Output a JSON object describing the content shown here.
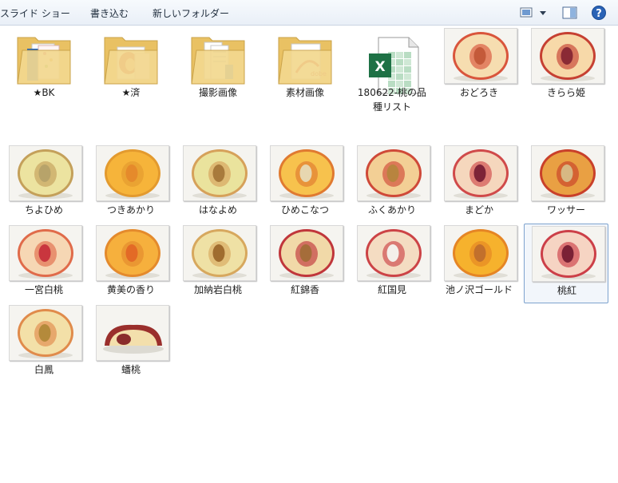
{
  "toolbar": {
    "commands": [
      "スライド ショー",
      "書き込む",
      "新しいフォルダー"
    ]
  },
  "colors": {
    "folder": "#f1d486",
    "excel_green": "#1e7145",
    "selection_border": "#7da2ce",
    "help_blue": "#2a63b6"
  },
  "items": [
    {
      "label": "★BK",
      "kind": "folder",
      "contents": "photoshop"
    },
    {
      "label": "★済",
      "kind": "folder",
      "contents": "peach"
    },
    {
      "label": "撮影画像",
      "kind": "folder",
      "contents": "docs"
    },
    {
      "label": "素材画像",
      "kind": "folder",
      "contents": "adobe"
    },
    {
      "label": "180622-桃の品種リスト",
      "kind": "excel",
      "icon": "excel-icon"
    },
    {
      "label": "おどろき",
      "kind": "peach",
      "flesh": "#f6ddb0",
      "red": "#d9553c",
      "pit": "#c45a3a"
    },
    {
      "label": "きらら姫",
      "kind": "peach",
      "flesh": "#f7d9a9",
      "red": "#c64032",
      "pit": "#8a2a35"
    },
    {
      "label": "ちよひめ",
      "kind": "peach",
      "flesh": "#ece3a0",
      "red": "#c4a05a",
      "pit": "#b7a36a"
    },
    {
      "label": "つきあかり",
      "kind": "peach",
      "flesh": "#f6b43a",
      "red": "#e39a2e",
      "pit": "#e58a2b"
    },
    {
      "label": "はなよめ",
      "kind": "peach",
      "flesh": "#eae39d",
      "red": "#d6a15a",
      "pit": "#a87a3c"
    },
    {
      "label": "ひめこなつ",
      "kind": "peach",
      "flesh": "#f7c24d",
      "red": "#e07a30",
      "pit": "#e7d7b0"
    },
    {
      "label": "ふくあかり",
      "kind": "peach",
      "flesh": "#f3cf95",
      "red": "#cf4938",
      "pit": "#b8843f"
    },
    {
      "label": "まどか",
      "kind": "peach",
      "flesh": "#f5d7bd",
      "red": "#d04a4a",
      "pit": "#7d2337"
    },
    {
      "label": "ワッサー",
      "kind": "peach",
      "flesh": "#e9a043",
      "red": "#c9402a",
      "pit": "#d7b884"
    },
    {
      "label": "一宮白桃",
      "kind": "peach",
      "flesh": "#f6d7b4",
      "red": "#e06b4a",
      "pit": "#c9363e"
    },
    {
      "label": "黄美の香り",
      "kind": "peach",
      "flesh": "#f6b03d",
      "red": "#e48a2c",
      "pit": "#e36a26"
    },
    {
      "label": "加納岩白桃",
      "kind": "peach",
      "flesh": "#efe1a5",
      "red": "#d7a85e",
      "pit": "#a06c2f"
    },
    {
      "label": "紅錦香",
      "kind": "peach",
      "flesh": "#f1d9a8",
      "red": "#c0363b",
      "pit": "#a56d3a"
    },
    {
      "label": "紅国見",
      "kind": "peach",
      "flesh": "#f4dcc2",
      "red": "#cc4346",
      "pit": "#f4f0ea"
    },
    {
      "label": "池ノ沢ゴールド",
      "kind": "peach",
      "flesh": "#f6b22d",
      "red": "#e58524",
      "pit": "#c2702c"
    },
    {
      "label": "桃紅",
      "kind": "peach",
      "flesh": "#f6d4c3",
      "red": "#cc3f48",
      "pit": "#7a2135",
      "selected": true
    },
    {
      "label": "白鳳",
      "kind": "peach",
      "flesh": "#f3e0a8",
      "red": "#e08b4b",
      "pit": "#b48a3b"
    },
    {
      "label": "蟠桃",
      "kind": "flatpeach",
      "flesh": "#f3dfac",
      "red": "#9a2f2c",
      "pit": "#8a2c2c"
    }
  ]
}
